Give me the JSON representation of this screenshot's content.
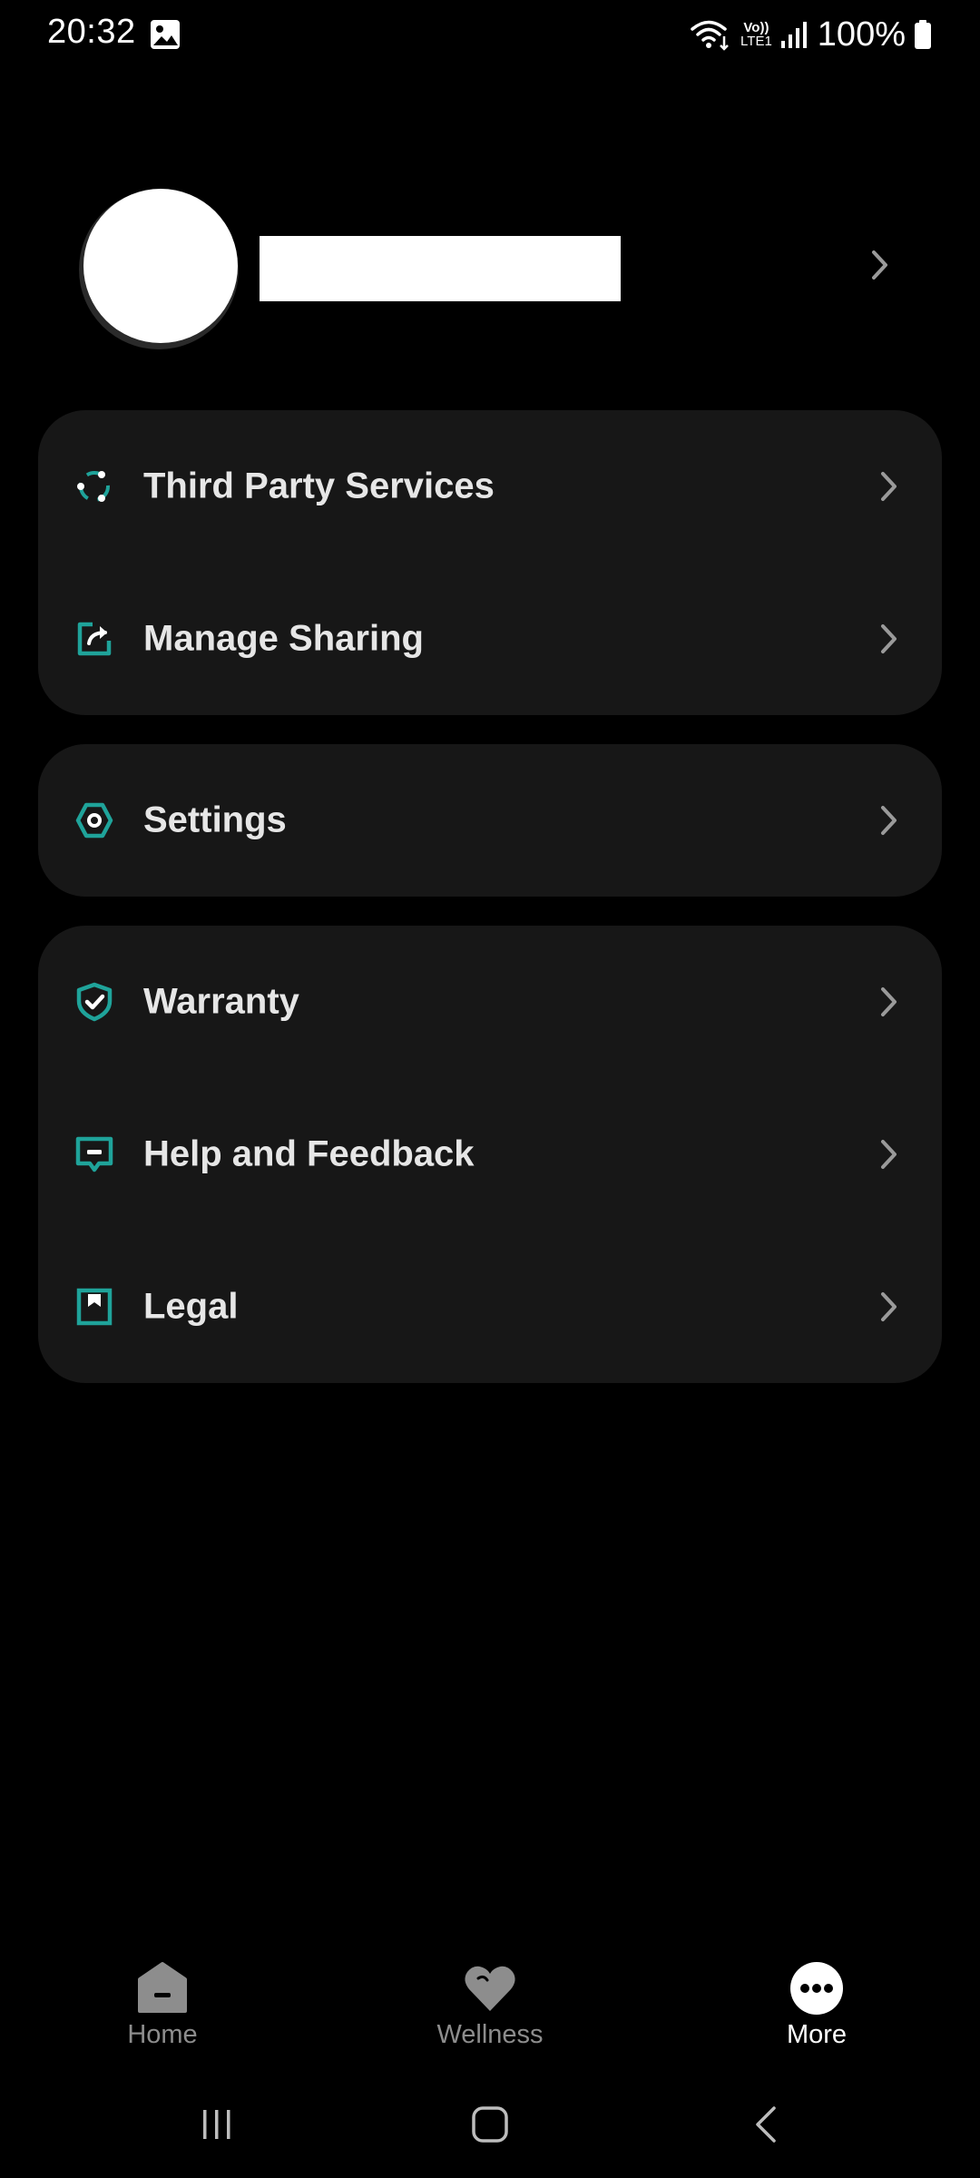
{
  "status_bar": {
    "time": "20:32",
    "battery_text": "100%",
    "icons": [
      "gallery-icon",
      "wifi-icon",
      "volte-icon",
      "signal-icon",
      "battery-icon"
    ],
    "volte_line1": "Vo))",
    "volte_line2": "LTE1"
  },
  "profile": {
    "name": ""
  },
  "menu": {
    "group1": [
      {
        "label": "Third Party Services",
        "icon": "third-party-services-icon"
      },
      {
        "label": "Manage Sharing",
        "icon": "share-icon"
      }
    ],
    "group2": [
      {
        "label": "Settings",
        "icon": "settings-icon"
      }
    ],
    "group3": [
      {
        "label": "Warranty",
        "icon": "shield-check-icon"
      },
      {
        "label": "Help and Feedback",
        "icon": "feedback-icon"
      },
      {
        "label": "Legal",
        "icon": "legal-icon"
      }
    ]
  },
  "bottom_nav": {
    "items": [
      {
        "label": "Home",
        "icon": "home-icon",
        "active": false
      },
      {
        "label": "Wellness",
        "icon": "heart-icon",
        "active": false
      },
      {
        "label": "More",
        "icon": "more-icon",
        "active": true
      }
    ]
  },
  "colors": {
    "background": "#000000",
    "card": "#171717",
    "accent": "#1fa39a",
    "text_primary": "#e6e6e6",
    "text_inactive": "#8d8d8d"
  }
}
